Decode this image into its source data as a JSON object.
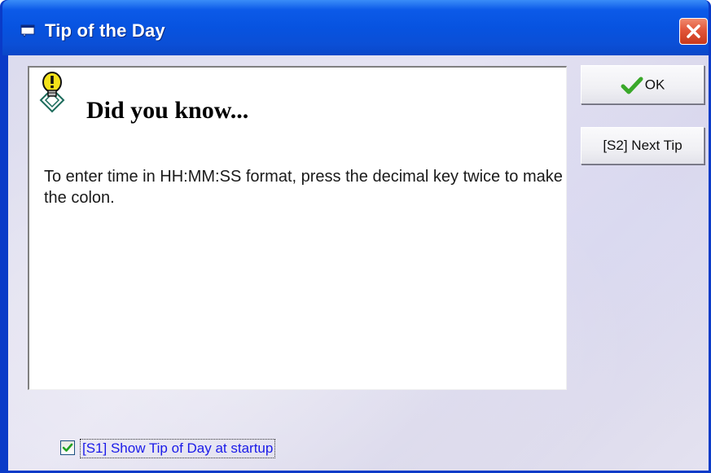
{
  "window": {
    "title": "Tip of the Day",
    "close_icon": "close-icon",
    "title_icon": "note-icon"
  },
  "tip": {
    "icon": "lightbulb-icon",
    "heading": "Did you know...",
    "text": "To enter time in HH:MM:SS format, press the decimal key twice to make the colon."
  },
  "buttons": {
    "ok_label": "OK",
    "ok_icon": "checkmark-icon",
    "next_label": "[S2] Next Tip"
  },
  "startup": {
    "label": "[S1] Show Tip of Day at startup",
    "checked": true
  },
  "colors": {
    "titlebar": "#0753e0",
    "close": "#e2563a",
    "link": "#1a1ae8",
    "check": "#3aa82a"
  }
}
